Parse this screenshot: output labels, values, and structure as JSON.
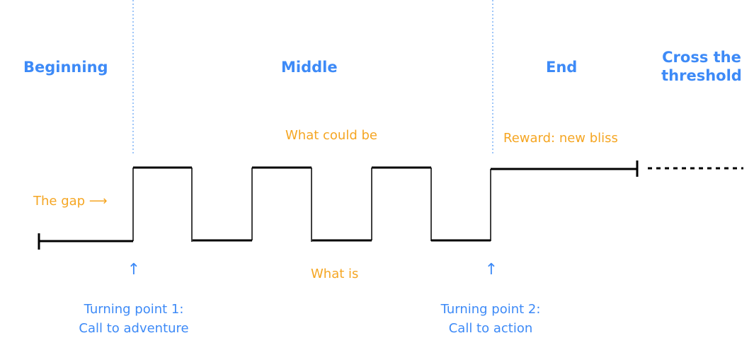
{
  "sections": [
    {
      "id": "beginning",
      "label": "Beginning"
    },
    {
      "id": "middle",
      "label": "Middle"
    },
    {
      "id": "end",
      "label": "End"
    },
    {
      "id": "cross",
      "label_line1": "Cross the",
      "label_line2": "threshold"
    }
  ],
  "annotations": {
    "the_gap": "The gap ⟶",
    "what_could_be": "What could be",
    "what_is": "What is",
    "reward": "Reward: new bliss"
  },
  "turning_points": [
    {
      "line1": "Turning point 1:",
      "line2": "Call to adventure",
      "arrow": "↑"
    },
    {
      "line1": "Turning point 2:",
      "line2": "Call to action",
      "arrow": "↑"
    }
  ],
  "waveform": {
    "description": "Square wave alternating between 'what is' (low) and 'what could be' (high), ending in sustained high 'new bliss'",
    "levels": [
      "low",
      "high",
      "low",
      "high",
      "low",
      "high",
      "low",
      "high-sustained"
    ],
    "oscillation_count": 3,
    "continues_dashed": true
  },
  "colors": {
    "section_title": "#3d8af7",
    "annotation": "#f5a623",
    "line": "#000000",
    "divider": "#7fb3f5"
  }
}
